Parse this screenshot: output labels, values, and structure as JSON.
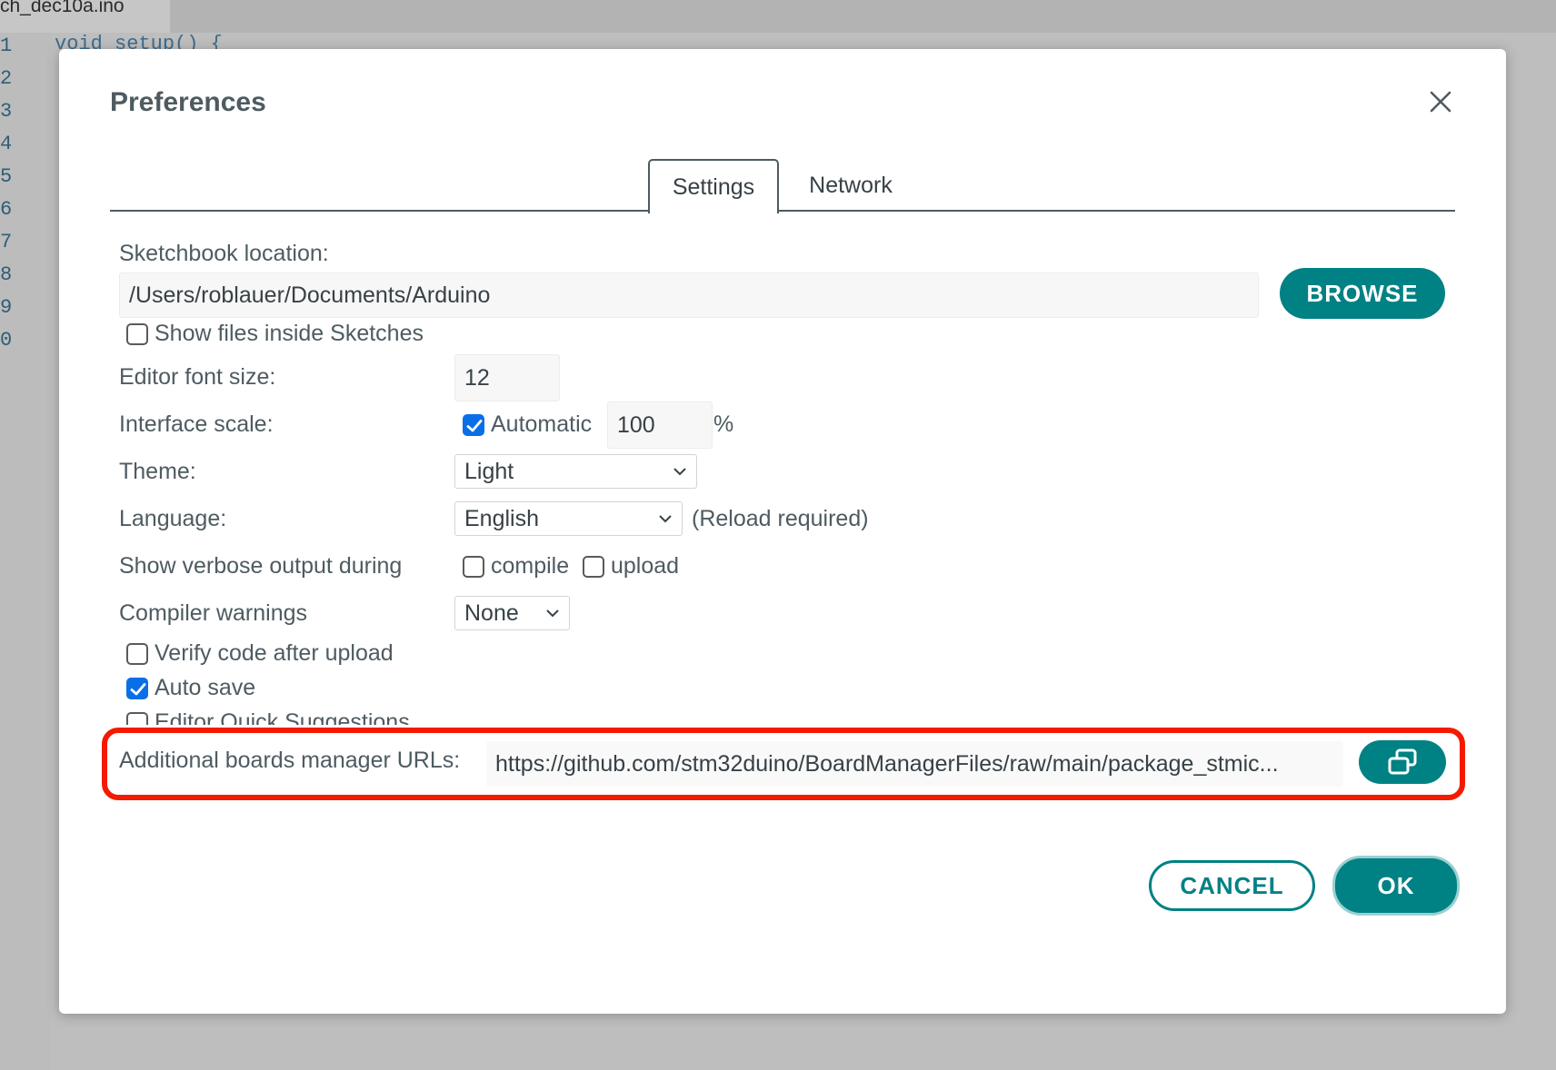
{
  "background": {
    "tab_name": "ch_dec10a.ino",
    "code_text": "void setup() {",
    "line_numbers": [
      "1",
      "2",
      "3",
      "4",
      "5",
      "6",
      "7",
      "8",
      "9",
      "0"
    ]
  },
  "dialog": {
    "title": "Preferences",
    "tabs": [
      {
        "label": "Settings",
        "active": true
      },
      {
        "label": "Network",
        "active": false
      }
    ],
    "sketchbook": {
      "label": "Sketchbook location:",
      "value": "/Users/roblauer/Documents/Arduino",
      "browse_label": "BROWSE"
    },
    "show_files": {
      "label": "Show files inside Sketches",
      "checked": false
    },
    "font_size": {
      "label": "Editor font size:",
      "value": "12"
    },
    "interface_scale": {
      "label": "Interface scale:",
      "automatic_label": "Automatic",
      "automatic_checked": true,
      "value": "100",
      "unit": "%"
    },
    "theme": {
      "label": "Theme:",
      "value": "Light"
    },
    "language": {
      "label": "Language:",
      "value": "English",
      "note": "(Reload required)"
    },
    "verbose": {
      "label": "Show verbose output during",
      "compile_label": "compile",
      "compile_checked": false,
      "upload_label": "upload",
      "upload_checked": false
    },
    "compiler_warnings": {
      "label": "Compiler warnings",
      "value": "None"
    },
    "verify": {
      "label": "Verify code after upload",
      "checked": false
    },
    "auto_save": {
      "label": "Auto save",
      "checked": true
    },
    "quick_suggestions": {
      "label": "Editor Quick Suggestions",
      "checked": false
    },
    "boards_urls": {
      "label": "Additional boards manager URLs:",
      "value": "https://github.com/stm32duino/BoardManagerFiles/raw/main/package_stmic..."
    },
    "cancel_label": "CANCEL",
    "ok_label": "OK"
  },
  "colors": {
    "accent": "#008184",
    "highlight": "#f41a00",
    "checkbox": "#0a6fe6"
  },
  "icons": [
    "close-icon",
    "open-window-icon",
    "chevron-down-icon",
    "checkmark-icon"
  ]
}
